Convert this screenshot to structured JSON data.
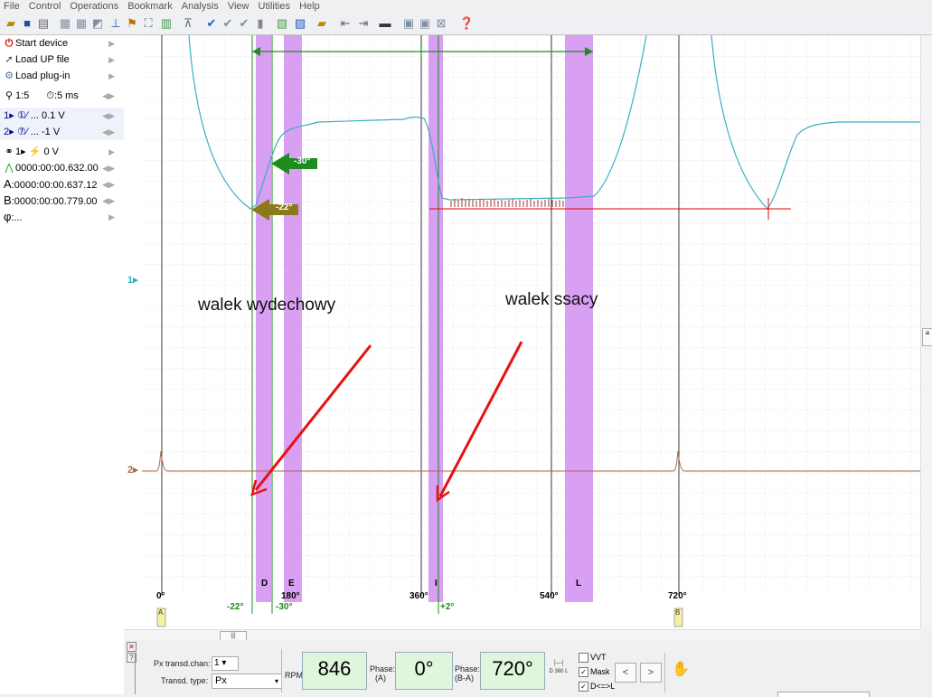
{
  "menu": [
    "File",
    "Control",
    "Operations",
    "Bookmark",
    "Analysis",
    "View",
    "Utilities",
    "Help"
  ],
  "sidebar": {
    "start_device": "Start device",
    "load_up": "Load UP file",
    "load_plugin": "Load plug-in",
    "scale": "1:5",
    "timebase": ":5 ms",
    "ch1": "... 0.1 V",
    "ch2": "... -1 V",
    "trigger": "0 V",
    "trigger_prefix": "1",
    "cursor_t": "0000:00:00.632.00",
    "cursor_a_label": "A",
    "cursor_a": ":0000:00:00.637.12",
    "cursor_b_label": "B",
    "cursor_b": ":0000:00:00.779.00",
    "phi_label": "φ",
    "phi": ":..."
  },
  "plot": {
    "ch1_marker": "1",
    "ch2_marker": "2",
    "annotation_exhaust": "walek wydechowy",
    "annotation_intake": "walek ssacy",
    "arrow_green": "-30°",
    "arrow_olive": "-22°",
    "deg_0": "0°",
    "deg_180": "180°",
    "deg_360": "360°",
    "deg_540": "540°",
    "deg_720": "720°",
    "green_m22": "-22°",
    "green_m30": "-30°",
    "green_p2": "+2°",
    "letter_d": "D",
    "letter_e": "E",
    "letter_i": "I",
    "letter_l": "L",
    "cursor_a_tag": "A",
    "cursor_b_tag": "B",
    "colors": {
      "ch1": "#3aaec0",
      "ch2": "#a86a4a",
      "band": "#d18ef0",
      "green": "#1e8c1e",
      "red": "#e00000"
    }
  },
  "bottom": {
    "px_chan_label": "Px transd.chan:",
    "px_chan_value": "1",
    "transd_type_label": "Transd. type:",
    "transd_type_value": "Px",
    "rpm_label": "RPM:",
    "rpm_value": "846",
    "phase_a_label": "Phase:",
    "phase_a_sub": "(A)",
    "phase_a_value": "0°",
    "phase_ba_label": "Phase:",
    "phase_ba_sub": "(B-A)",
    "phase_ba_value": "720°",
    "dsl_label": "D 360 L",
    "vvt_label": "VVT",
    "mask_label": "Mask",
    "dl_label": "D<=>L",
    "prev": "<",
    "next": ">",
    "hand": "✋"
  }
}
